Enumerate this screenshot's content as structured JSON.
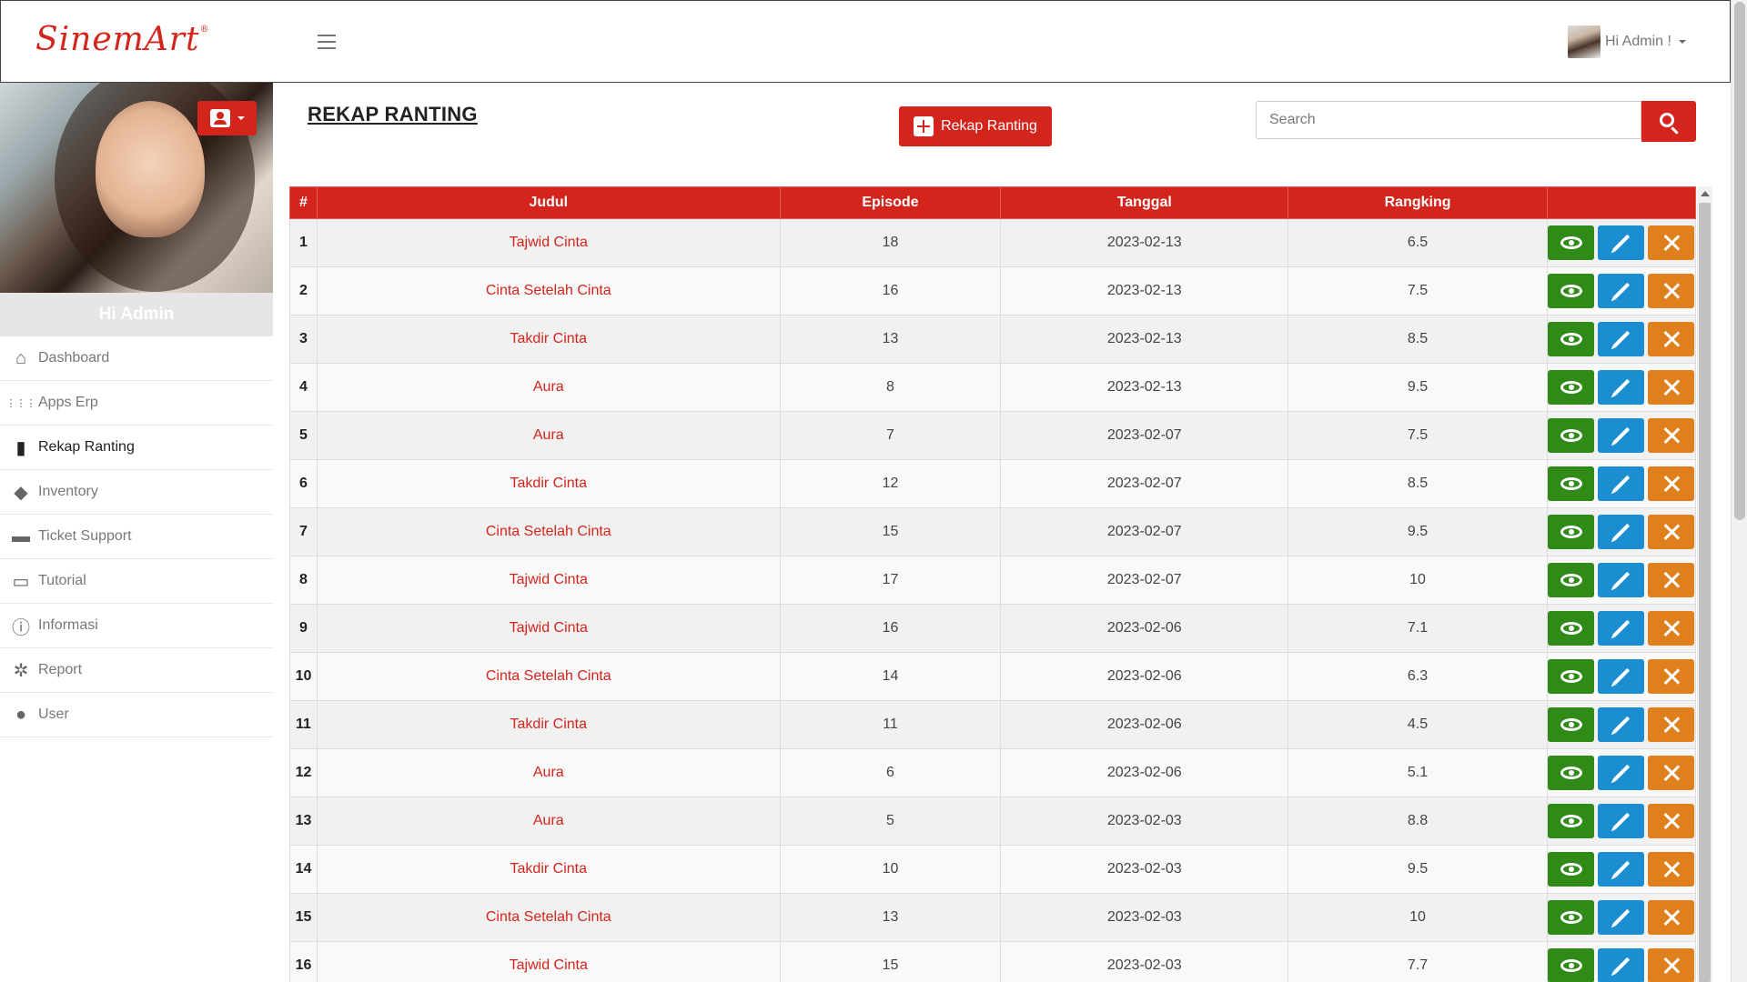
{
  "header": {
    "logo": "SinemArt",
    "logo_mark": "®",
    "user_greeting": "Hi Admin !"
  },
  "sidebar": {
    "greeting": "Hi Admin",
    "items": [
      {
        "label": "Dashboard",
        "icon": "home-icon"
      },
      {
        "label": "Apps Erp",
        "icon": "grid-icon"
      },
      {
        "label": "Rekap Ranting",
        "icon": "bar-chart-icon"
      },
      {
        "label": "Inventory",
        "icon": "bag-icon"
      },
      {
        "label": "Ticket Support",
        "icon": "ticket-icon"
      },
      {
        "label": "Tutorial",
        "icon": "monitor-icon"
      },
      {
        "label": "Informasi",
        "icon": "info-icon"
      },
      {
        "label": "Report",
        "icon": "bug-icon"
      },
      {
        "label": "User",
        "icon": "user-icon"
      }
    ],
    "active": "Rekap Ranting"
  },
  "main": {
    "title": "REKAP RANTING",
    "add_button": "Rekap Ranting",
    "search_placeholder": "Search"
  },
  "colors": {
    "primary": "#d4251c",
    "view": "#2f8a18",
    "edit": "#1a8ed1",
    "delete": "#e0801d"
  },
  "table": {
    "headers": [
      "#",
      "Judul",
      "Episode",
      "Tanggal",
      "Rangking",
      ""
    ],
    "rows": [
      [
        "1",
        "Tajwid Cinta",
        "18",
        "2023-02-13",
        "6.5"
      ],
      [
        "2",
        "Cinta Setelah Cinta",
        "16",
        "2023-02-13",
        "7.5"
      ],
      [
        "3",
        "Takdir Cinta",
        "13",
        "2023-02-13",
        "8.5"
      ],
      [
        "4",
        "Aura",
        "8",
        "2023-02-13",
        "9.5"
      ],
      [
        "5",
        "Aura",
        "7",
        "2023-02-07",
        "7.5"
      ],
      [
        "6",
        "Takdir Cinta",
        "12",
        "2023-02-07",
        "8.5"
      ],
      [
        "7",
        "Cinta Setelah Cinta",
        "15",
        "2023-02-07",
        "9.5"
      ],
      [
        "8",
        "Tajwid Cinta",
        "17",
        "2023-02-07",
        "10"
      ],
      [
        "9",
        "Tajwid Cinta",
        "16",
        "2023-02-06",
        "7.1"
      ],
      [
        "10",
        "Cinta Setelah Cinta",
        "14",
        "2023-02-06",
        "6.3"
      ],
      [
        "11",
        "Takdir Cinta",
        "11",
        "2023-02-06",
        "4.5"
      ],
      [
        "12",
        "Aura",
        "6",
        "2023-02-06",
        "5.1"
      ],
      [
        "13",
        "Aura",
        "5",
        "2023-02-03",
        "8.8"
      ],
      [
        "14",
        "Takdir Cinta",
        "10",
        "2023-02-03",
        "9.5"
      ],
      [
        "15",
        "Cinta Setelah Cinta",
        "13",
        "2023-02-03",
        "10"
      ],
      [
        "16",
        "Tajwid Cinta",
        "15",
        "2023-02-03",
        "7.7"
      ]
    ]
  }
}
